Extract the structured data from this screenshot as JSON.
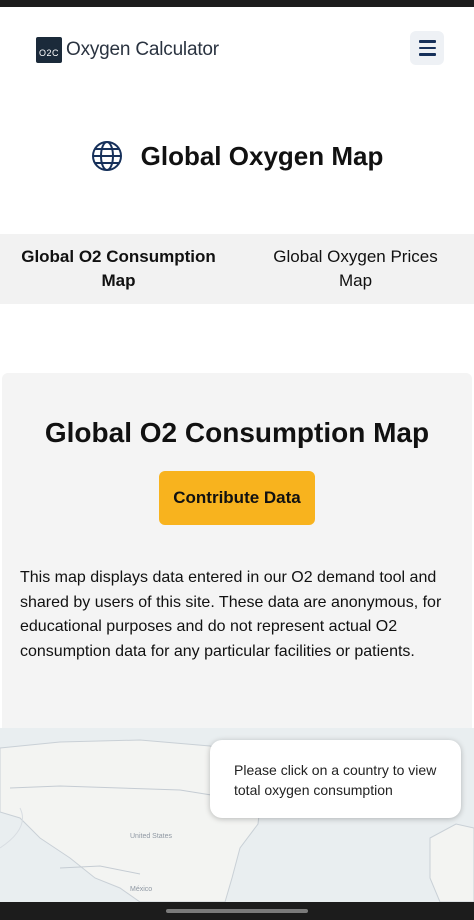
{
  "header": {
    "logo_mark": "O2C",
    "logo_text": "Oxygen Calculator"
  },
  "page": {
    "title": "Global Oxygen Map"
  },
  "tabs": [
    {
      "label": "Global O2 Consumption Map",
      "active": true
    },
    {
      "label": "Global Oxygen Prices Map",
      "active": false
    }
  ],
  "section": {
    "title": "Global O2 Consumption Map",
    "button_label": "Contribute Data",
    "description": "This map displays data entered in our O2 demand tool and shared by users of this site. These data are anonymous, for educational purposes and do not represent actual O2 consumption data for any particular facilities or patients."
  },
  "map": {
    "tooltip": "Please click on a country to view total oxygen consumption",
    "labels": {
      "country_1": "United States",
      "country_2": "México"
    }
  },
  "colors": {
    "accent_button": "#f8b31e",
    "menu_icon": "#16305a",
    "logo_bg": "#1b2a3a"
  }
}
